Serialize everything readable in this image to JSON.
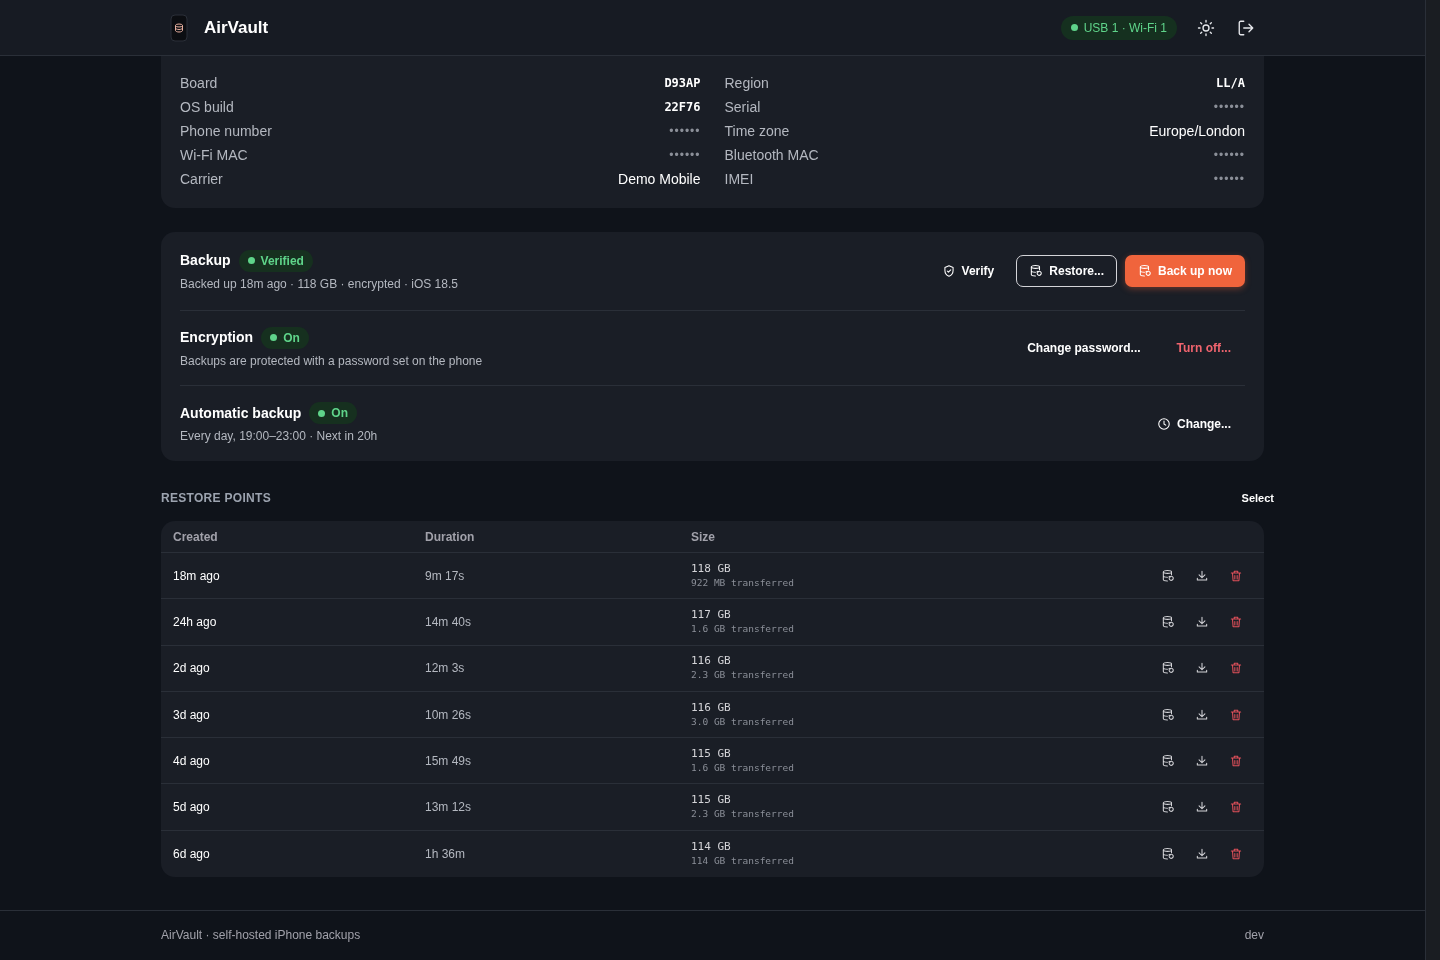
{
  "header": {
    "app_name": "AirVault",
    "connection": "USB 1 · Wi-Fi 1"
  },
  "device_info": {
    "left": [
      {
        "label": "Board",
        "value": "D93AP",
        "kind": "code"
      },
      {
        "label": "OS build",
        "value": "22F76",
        "kind": "code"
      },
      {
        "label": "Phone number",
        "value": "••••••",
        "kind": "masked"
      },
      {
        "label": "Wi-Fi MAC",
        "value": "••••••",
        "kind": "masked"
      },
      {
        "label": "Carrier",
        "value": "Demo Mobile",
        "kind": "text"
      }
    ],
    "right": [
      {
        "label": "Region",
        "value": "LL/A",
        "kind": "code"
      },
      {
        "label": "Serial",
        "value": "••••••",
        "kind": "masked"
      },
      {
        "label": "Time zone",
        "value": "Europe/London",
        "kind": "text"
      },
      {
        "label": "Bluetooth MAC",
        "value": "••••••",
        "kind": "masked"
      },
      {
        "label": "IMEI",
        "value": "••••••",
        "kind": "masked"
      }
    ]
  },
  "sections": [
    {
      "title": "Backup",
      "badge": "Verified",
      "details": "Backed up 18m ago · 118 GB · encrypted · iOS 18.5",
      "actions": [
        {
          "label": "Verify",
          "kind": "ghost"
        },
        {
          "label": "Restore...",
          "kind": "outline"
        },
        {
          "label": "Back up now",
          "kind": "primary"
        }
      ]
    },
    {
      "title": "Encryption",
      "badge": "On",
      "details": "Backups are protected with a password set on the phone",
      "actions": [
        {
          "label": "Change password...",
          "kind": "ghost"
        },
        {
          "label": "Turn off...",
          "kind": "danger"
        }
      ]
    },
    {
      "title": "Automatic backup",
      "badge": "On",
      "details": "Every day, 19:00–23:00 · Next in 20h",
      "actions": [
        {
          "label": "Change...",
          "kind": "ghost"
        }
      ]
    }
  ],
  "restore_points": {
    "heading": "RESTORE POINTS",
    "select": "Select",
    "columns": [
      "Created",
      "Duration",
      "Size"
    ],
    "rows": [
      {
        "created": "18m ago",
        "duration": "9m 17s",
        "size": "118 GB",
        "transferred": "922 MB transferred"
      },
      {
        "created": "24h ago",
        "duration": "14m 40s",
        "size": "117 GB",
        "transferred": "1.6 GB transferred"
      },
      {
        "created": "2d ago",
        "duration": "12m 3s",
        "size": "116 GB",
        "transferred": "2.3 GB transferred"
      },
      {
        "created": "3d ago",
        "duration": "10m 26s",
        "size": "116 GB",
        "transferred": "3.0 GB transferred"
      },
      {
        "created": "4d ago",
        "duration": "15m 49s",
        "size": "115 GB",
        "transferred": "1.6 GB transferred"
      },
      {
        "created": "5d ago",
        "duration": "13m 12s",
        "size": "115 GB",
        "transferred": "2.3 GB transferred"
      },
      {
        "created": "6d ago",
        "duration": "1h 36m",
        "size": "114 GB",
        "transferred": "114 GB transferred"
      }
    ]
  },
  "footer": {
    "text": "AirVault · self-hosted iPhone backups",
    "version": "dev"
  }
}
